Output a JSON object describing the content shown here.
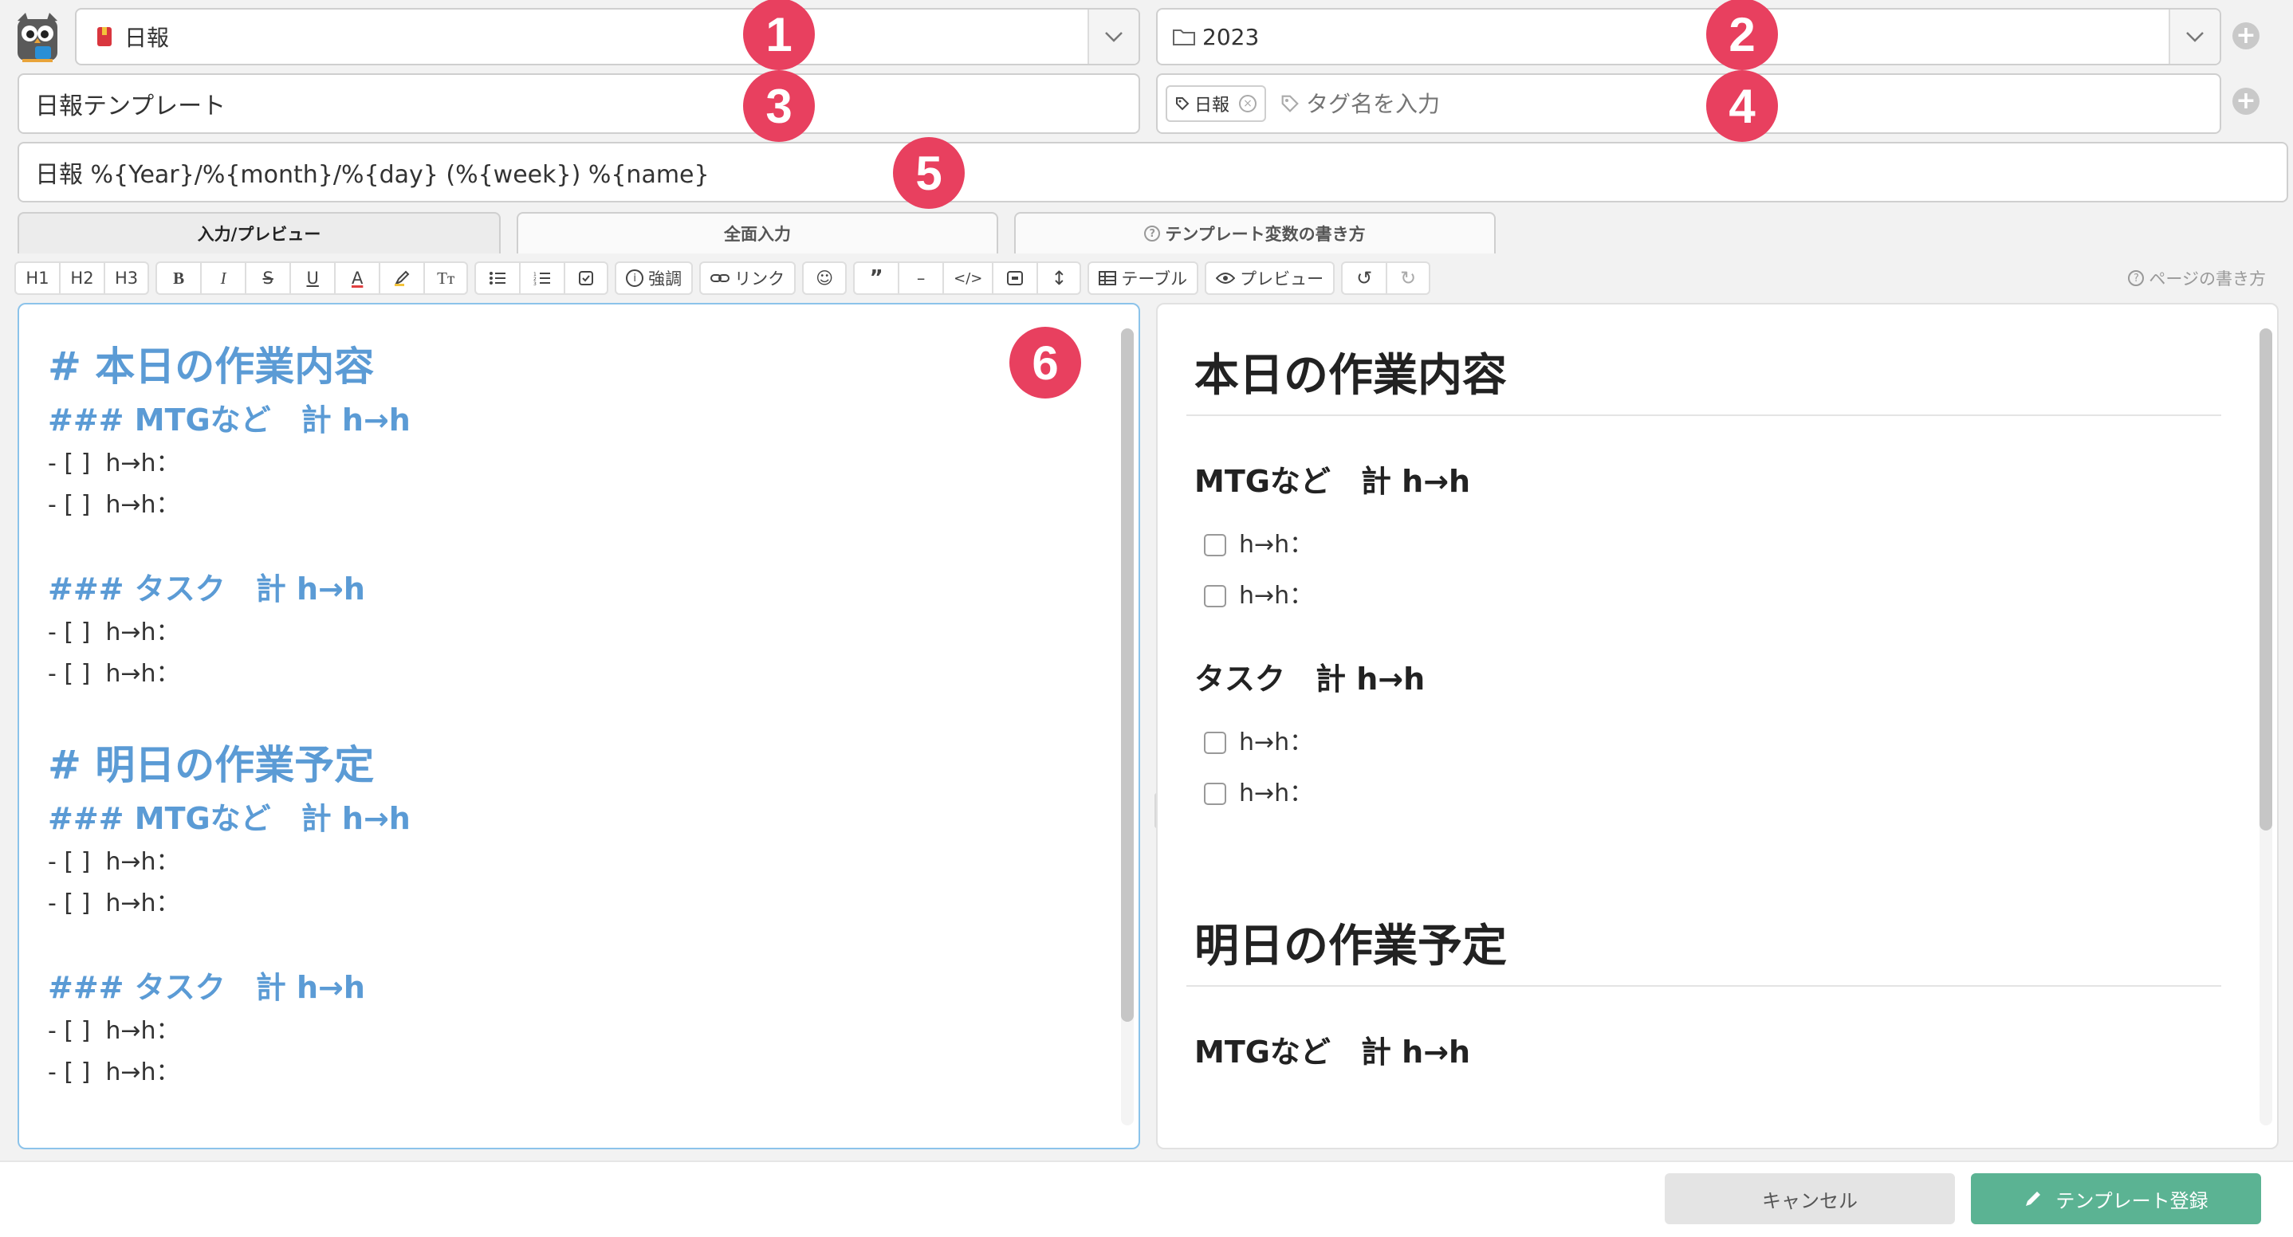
{
  "header": {
    "category_select": {
      "value": "日報",
      "badge": "1"
    },
    "folder_select": {
      "value": "2023",
      "badge": "2"
    },
    "template_name": {
      "value": "日報テンプレート",
      "badge": "3"
    },
    "tags": {
      "chips": [
        "日報"
      ],
      "placeholder": "タグ名を入力",
      "badge": "4"
    },
    "title_format": {
      "value": "日報 %{Year}/%{month}/%{day} (%{week}) %{name}",
      "badge": "5"
    }
  },
  "tabs": [
    {
      "label": "入力/プレビュー",
      "active": true
    },
    {
      "label": "全面入力",
      "active": false
    },
    {
      "label": "テンプレート変数の書き方",
      "active": false
    }
  ],
  "toolbar": {
    "headings": [
      "H1",
      "H2",
      "H3"
    ],
    "emphasis_label": "強調",
    "link_label": "リンク",
    "table_label": "テーブル",
    "preview_label": "プレビュー",
    "help_label": "ページの書き方"
  },
  "editor": {
    "badge": "6",
    "lines": [
      {
        "type": "h1",
        "text": "# 本日の作業内容"
      },
      {
        "type": "h3",
        "text": "### MTGなど　計 h→h"
      },
      {
        "type": "item",
        "text": "- [ ]  h→h："
      },
      {
        "type": "item",
        "text": "- [ ]  h→h："
      },
      {
        "type": "blank",
        "text": ""
      },
      {
        "type": "h3",
        "text": "### タスク　計 h→h"
      },
      {
        "type": "item",
        "text": "- [ ]  h→h："
      },
      {
        "type": "item",
        "text": "- [ ]  h→h："
      },
      {
        "type": "blank",
        "text": ""
      },
      {
        "type": "h1",
        "text": "# 明日の作業予定"
      },
      {
        "type": "h3",
        "text": "### MTGなど　計 h→h"
      },
      {
        "type": "item",
        "text": "- [ ]  h→h："
      },
      {
        "type": "item",
        "text": "- [ ]  h→h："
      },
      {
        "type": "blank",
        "text": ""
      },
      {
        "type": "h3",
        "text": "### タスク　計 h→h"
      },
      {
        "type": "item",
        "text": "- [ ]  h→h："
      },
      {
        "type": "item",
        "text": "- [ ]  h→h："
      }
    ]
  },
  "preview": {
    "h1_today": "本日の作業内容",
    "h3_mtg": "MTGなど　計 h→h",
    "h3_task": "タスク　計 h→h",
    "item": "h→h：",
    "h1_tomorrow": "明日の作業予定",
    "h3_mtg2": "MTGなど　計 h→h"
  },
  "footer": {
    "cancel_label": "キャンセル",
    "register_label": "テンプレート登録"
  },
  "colors": {
    "badge": "#e8405f",
    "heading_blue": "#5b9bd5",
    "register_green": "#5bb393"
  }
}
